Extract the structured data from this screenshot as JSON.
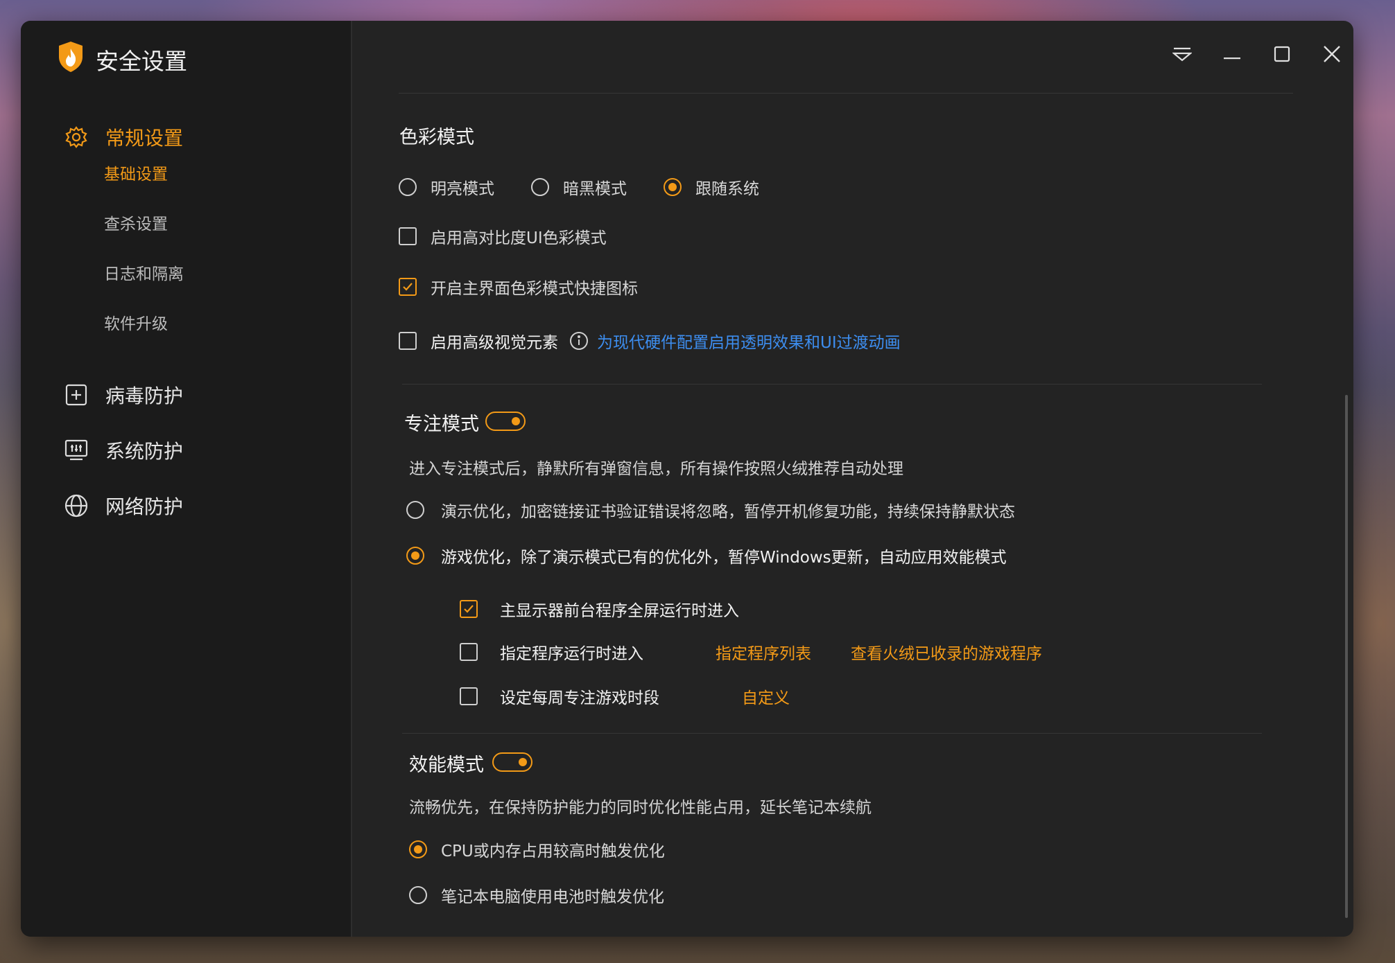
{
  "app": {
    "title": "安全设置",
    "logo_icon": "shield-flame-icon"
  },
  "colors": {
    "accent": "#f39a17",
    "link": "#3d8ef0",
    "window_bg": "#232323",
    "sidebar_bg": "#1b1b1b"
  },
  "sidebar": {
    "sections": [
      {
        "label": "常规设置",
        "icon": "gear-icon",
        "active": true
      },
      {
        "label": "病毒防护",
        "icon": "plus-square-icon"
      },
      {
        "label": "系统防护",
        "icon": "system-monitor-icon"
      },
      {
        "label": "网络防护",
        "icon": "globe-icon"
      }
    ],
    "sub_items": [
      {
        "label": "基础设置",
        "active": true
      },
      {
        "label": "查杀设置"
      },
      {
        "label": "日志和隔离"
      },
      {
        "label": "软件升级"
      }
    ]
  },
  "titlebar": {
    "buttons": [
      "menu-icon",
      "minimize-icon",
      "maximize-icon",
      "close-icon"
    ]
  },
  "color_mode": {
    "title": "色彩模式",
    "options": [
      {
        "label": "明亮模式",
        "selected": false
      },
      {
        "label": "暗黑模式",
        "selected": false
      },
      {
        "label": "跟随系统",
        "selected": true
      }
    ],
    "checkboxes": [
      {
        "label": "启用高对比度UI色彩模式",
        "checked": false
      },
      {
        "label": "开启主界面色彩模式快捷图标",
        "checked": true
      },
      {
        "label": "启用高级视觉元素",
        "checked": false
      }
    ],
    "visual_link": "为现代硬件配置启用透明效果和UI过渡动画"
  },
  "focus_mode": {
    "title": "专注模式",
    "enabled": true,
    "description": "进入专注模式后，静默所有弹窗信息，所有操作按照火绒推荐自动处理",
    "options": [
      {
        "label": "演示优化，加密链接证书验证错误将忽略，暂停开机修复功能，持续保持静默状态",
        "selected": false
      },
      {
        "label": "游戏优化，除了演示模式已有的优化外，暂停Windows更新，自动应用效能模式",
        "selected": true
      }
    ],
    "sub_checks": [
      {
        "label": "主显示器前台程序全屏运行时进入",
        "checked": true
      },
      {
        "label": "指定程序运行时进入",
        "checked": false
      },
      {
        "label": "设定每周专注游戏时段",
        "checked": false
      }
    ],
    "links": {
      "program_list": "指定程序列表",
      "game_list": "查看火绒已收录的游戏程序",
      "custom": "自定义"
    }
  },
  "efficiency_mode": {
    "title": "效能模式",
    "enabled": true,
    "description": "流畅优先，在保持防护能力的同时优化性能占用，延长笔记本续航",
    "options": [
      {
        "label": "CPU或内存占用较高时触发优化",
        "selected": true
      },
      {
        "label": "笔记本电脑使用电池时触发优化",
        "selected": false
      }
    ]
  }
}
